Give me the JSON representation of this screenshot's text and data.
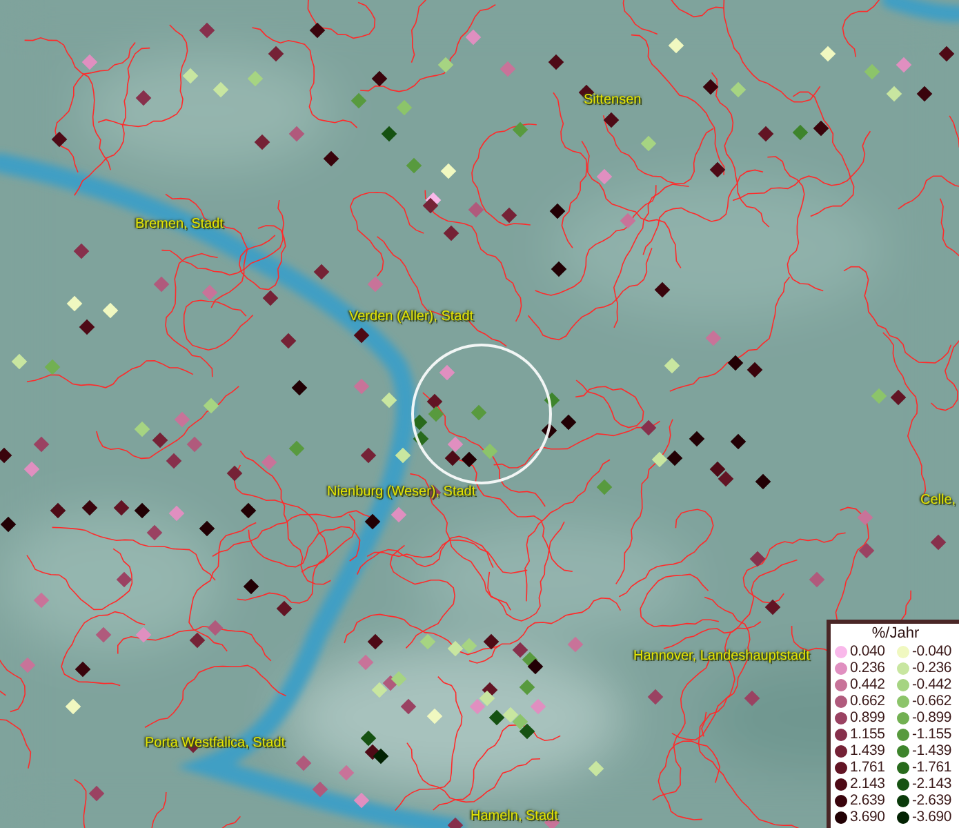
{
  "map": {
    "place_labels": [
      {
        "text": "Sittensen"
      },
      {
        "text": "Bremen, Stadt"
      },
      {
        "text": "Verden (Aller), Stadt"
      },
      {
        "text": "Nienburg (Weser), Stadt"
      },
      {
        "text": "Celle,"
      },
      {
        "text": "Hannover, Landeshauptstadt"
      },
      {
        "text": "Porta Westfalica, Stadt"
      },
      {
        "text": "Hameln, Stadt"
      }
    ]
  },
  "legend": {
    "title": "%/Jahr",
    "positive_classes": [
      {
        "label": "0.040",
        "color": "#f9b8ea"
      },
      {
        "label": "0.236",
        "color": "#e08fc0"
      },
      {
        "label": "0.442",
        "color": "#c87399"
      },
      {
        "label": "0.662",
        "color": "#b05a7c"
      },
      {
        "label": "0.899",
        "color": "#9a4262"
      },
      {
        "label": "1.155",
        "color": "#87304c"
      },
      {
        "label": "1.439",
        "color": "#752236"
      },
      {
        "label": "1.761",
        "color": "#621424"
      },
      {
        "label": "2.143",
        "color": "#4e0a16"
      },
      {
        "label": "2.639",
        "color": "#3a040c"
      },
      {
        "label": "3.690",
        "color": "#220004"
      }
    ],
    "negative_classes": [
      {
        "label": "-0.040",
        "color": "#f0f8c0"
      },
      {
        "label": "-0.236",
        "color": "#c8e6a0"
      },
      {
        "label": "-0.442",
        "color": "#a6d482"
      },
      {
        "label": "-0.662",
        "color": "#8cc46a"
      },
      {
        "label": "-0.899",
        "color": "#72b052"
      },
      {
        "label": "-1.155",
        "color": "#589a3e"
      },
      {
        "label": "-1.439",
        "color": "#3e842c"
      },
      {
        "label": "-1.761",
        "color": "#286a1c"
      },
      {
        "label": "-2.143",
        "color": "#165212"
      },
      {
        "label": "-2.639",
        "color": "#0a3a0a"
      },
      {
        "label": "-3.690",
        "color": "#022202"
      }
    ]
  }
}
